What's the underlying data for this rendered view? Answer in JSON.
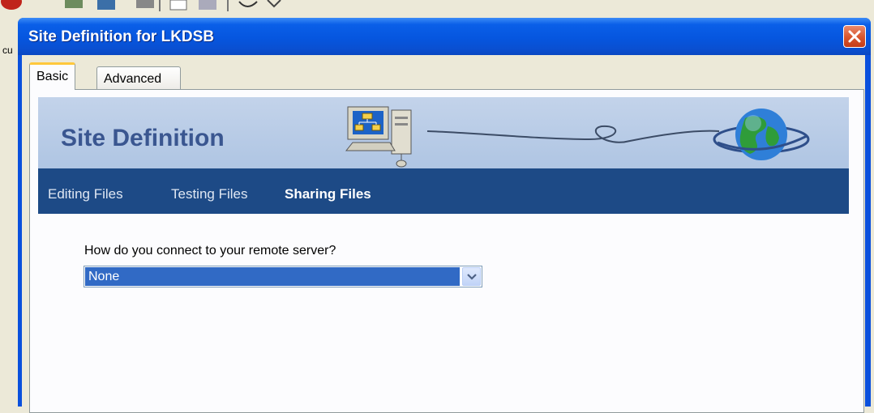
{
  "background": {
    "partial_text": "cu"
  },
  "window": {
    "title": "Site Definition for LKDSB"
  },
  "tabs": [
    {
      "label": "Basic",
      "selected": true
    },
    {
      "label": "Advanced",
      "selected": false
    }
  ],
  "banner": {
    "title": "Site Definition"
  },
  "steps": [
    {
      "label": "Editing Files",
      "active": false
    },
    {
      "label": "Testing Files",
      "active": false
    },
    {
      "label": "Sharing Files",
      "active": true
    }
  ],
  "form": {
    "question": "How do you connect to your remote server?",
    "connection": {
      "selected": "None"
    }
  },
  "colors": {
    "title_bar": "#0a5fe8",
    "nav_bar": "#1d4a86",
    "selection": "#316ac5",
    "close_button": "#d8542c"
  }
}
